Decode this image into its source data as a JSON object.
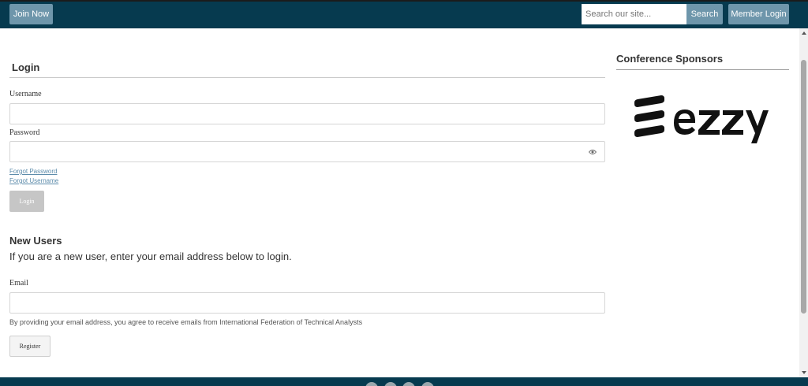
{
  "header": {
    "join_label": "Join Now",
    "search_placeholder": "Search our site...",
    "search_label": "Search",
    "member_login_label": "Member Login"
  },
  "login": {
    "heading": "Login",
    "username_label": "Username",
    "password_label": "Password",
    "forgot_password": "Forgot Password",
    "forgot_username": "Forgot Username",
    "submit_label": "Login"
  },
  "new_users": {
    "heading": "New Users",
    "instructions": "If you are a new user, enter your email address below to login.",
    "email_label": "Email",
    "consent": "By providing your email address, you agree to receive emails from International Federation of Technical Analysts",
    "register_label": "Register"
  },
  "sidebar": {
    "heading": "Conference Sponsors",
    "sponsor_logo_text": "ezzy"
  },
  "colors": {
    "header_bg": "#063a4f",
    "button_bg": "#6e96ab",
    "link": "#5d8cab"
  },
  "icons": {
    "password_toggle": "eye-icon"
  }
}
